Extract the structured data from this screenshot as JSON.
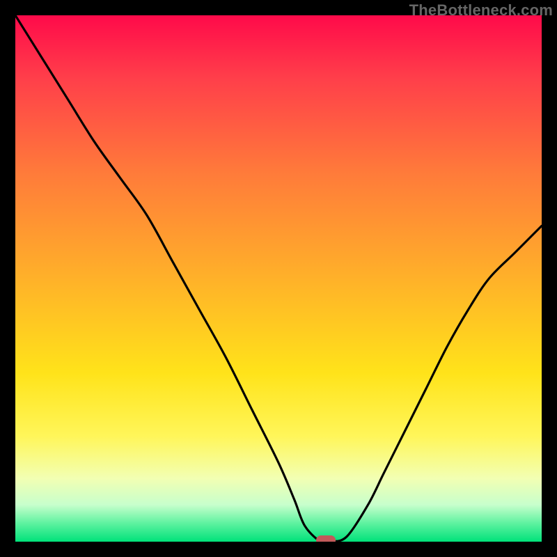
{
  "watermark": "TheBottleneck.com",
  "chart_data": {
    "type": "line",
    "title": "",
    "xlabel": "",
    "ylabel": "",
    "xlim": [
      0,
      100
    ],
    "ylim": [
      0,
      100
    ],
    "series": [
      {
        "name": "bottleneck-curve",
        "x": [
          0,
          5,
          10,
          15,
          20,
          25,
          30,
          35,
          40,
          45,
          50,
          53,
          55,
          58,
          60,
          63,
          67,
          70,
          74,
          78,
          82,
          86,
          90,
          95,
          100
        ],
        "y": [
          100,
          92,
          84,
          76,
          69,
          62,
          53,
          44,
          35,
          25,
          15,
          8,
          3,
          0,
          0,
          1,
          7,
          13,
          21,
          29,
          37,
          44,
          50,
          55,
          60
        ]
      }
    ],
    "marker": {
      "x": 59,
      "y": 0,
      "color": "#c25a5a"
    },
    "gradient_stops": [
      {
        "offset": 0.0,
        "color": "#ff0a4a"
      },
      {
        "offset": 0.12,
        "color": "#ff3f4a"
      },
      {
        "offset": 0.3,
        "color": "#ff7b3a"
      },
      {
        "offset": 0.5,
        "color": "#ffb129"
      },
      {
        "offset": 0.68,
        "color": "#ffe31a"
      },
      {
        "offset": 0.8,
        "color": "#fff65a"
      },
      {
        "offset": 0.88,
        "color": "#f2ffb3"
      },
      {
        "offset": 0.93,
        "color": "#c7ffcc"
      },
      {
        "offset": 0.965,
        "color": "#5ef2a0"
      },
      {
        "offset": 1.0,
        "color": "#00e27a"
      }
    ]
  }
}
